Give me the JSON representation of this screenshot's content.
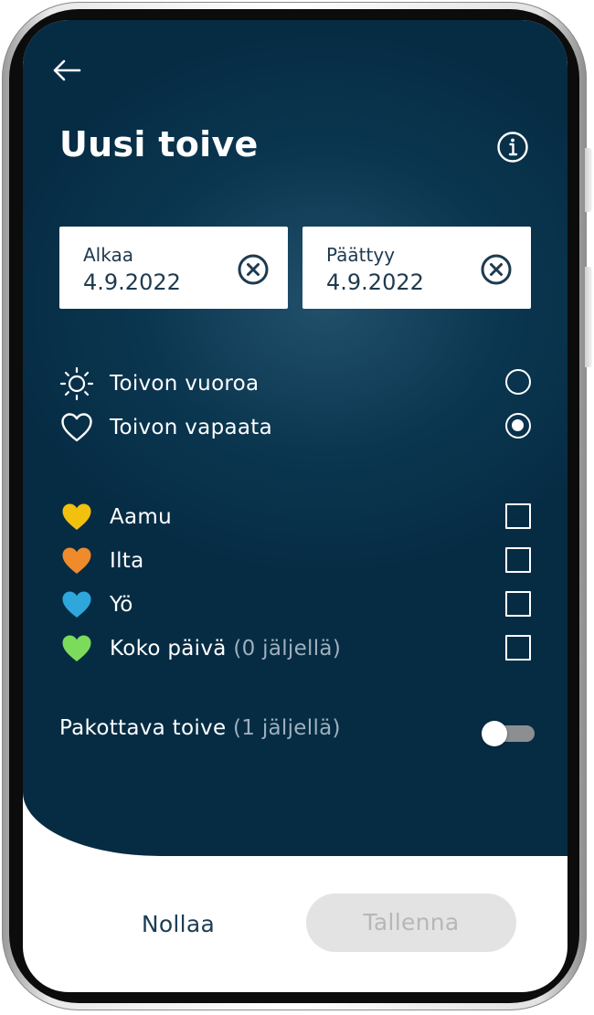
{
  "header": {
    "title": "Uusi toive"
  },
  "dates": {
    "start": {
      "label": "Alkaa",
      "value": "4.9.2022"
    },
    "end": {
      "label": "Päättyy",
      "value": "4.9.2022"
    }
  },
  "wish_type": {
    "options": [
      {
        "label": "Toivon vuoroa",
        "icon": "sun-icon",
        "selected": false
      },
      {
        "label": "Toivon vapaata",
        "icon": "heart-outline-icon",
        "selected": true
      }
    ]
  },
  "shifts": [
    {
      "label": "Aamu",
      "suffix": "",
      "color": "#f2c10e",
      "checked": false
    },
    {
      "label": "Ilta",
      "suffix": "",
      "color": "#ef8b2b",
      "checked": false
    },
    {
      "label": "Yö",
      "suffix": "",
      "color": "#2ea7dd",
      "checked": false
    },
    {
      "label": "Koko päivä",
      "suffix": "(0 jäljellä)",
      "color": "#7ddb5b",
      "checked": false
    }
  ],
  "forced": {
    "label": "Pakottava toive",
    "suffix": "(1 jäljellä)",
    "enabled": false
  },
  "actions": {
    "reset_label": "Nollaa",
    "save_label": "Tallenna"
  },
  "colors": {
    "background": "#0b3650",
    "text_dark": "#1b3d55",
    "disabled_bg": "#e3e3e3",
    "disabled_text": "#b7b7b7"
  }
}
